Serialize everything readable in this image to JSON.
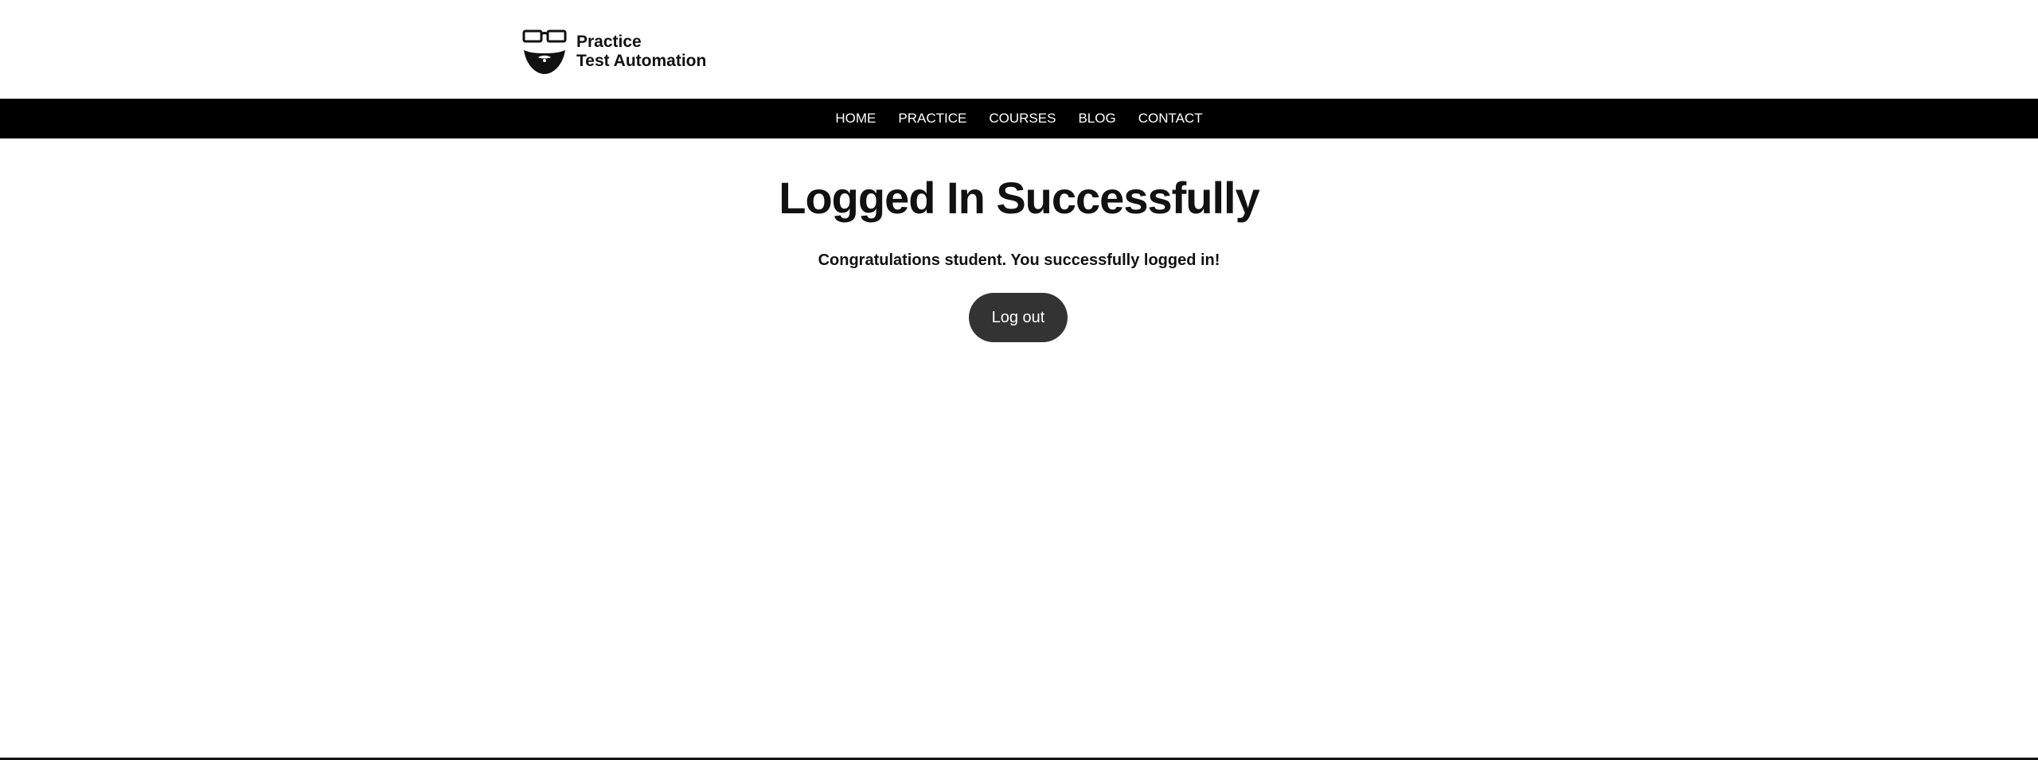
{
  "brand": {
    "line1": "Practice",
    "line2": "Test Automation",
    "logo_icon": "glasses-beard-icon"
  },
  "nav": {
    "items": [
      {
        "label": "HOME"
      },
      {
        "label": "PRACTICE"
      },
      {
        "label": "COURSES"
      },
      {
        "label": "BLOG"
      },
      {
        "label": "CONTACT"
      }
    ]
  },
  "main": {
    "title": "Logged In Successfully",
    "message": "Congratulations student. You successfully logged in!",
    "logout_label": "Log out"
  },
  "colors": {
    "nav_background": "#000000",
    "button_background": "#333333",
    "text": "#111111"
  }
}
